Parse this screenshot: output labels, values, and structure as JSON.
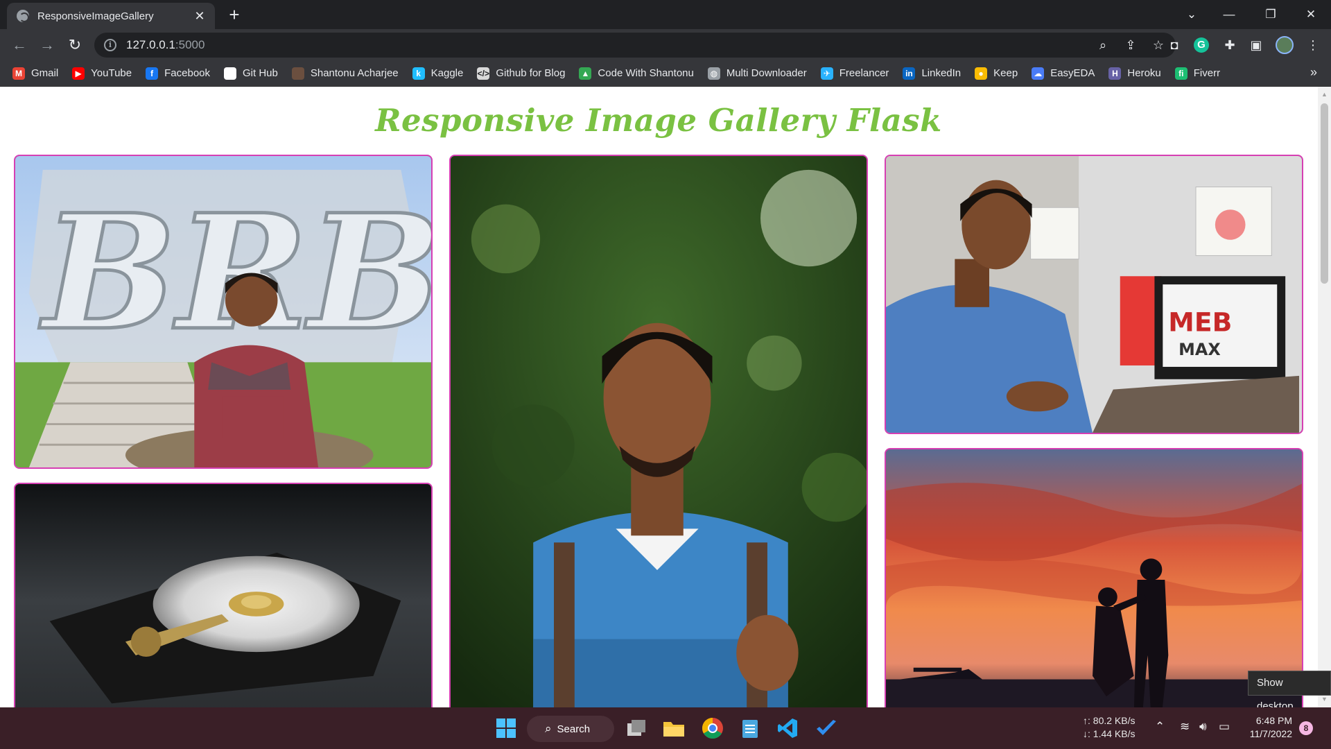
{
  "browser": {
    "tab_title": "ResponsiveImageGallery",
    "tab_close": "✕",
    "new_tab": "+",
    "url_host": "127.0.0.1",
    "url_port": ":5000"
  },
  "bookmarks": [
    {
      "label": "Gmail",
      "icon": "gmail-icon",
      "color": "#ea4335",
      "glyph": "M"
    },
    {
      "label": "YouTube",
      "icon": "youtube-icon",
      "color": "#ff0000",
      "glyph": "▶"
    },
    {
      "label": "Facebook",
      "icon": "facebook-icon",
      "color": "#1877f2",
      "glyph": "f"
    },
    {
      "label": "Git Hub",
      "icon": "github-icon",
      "color": "#ffffff",
      "glyph": ""
    },
    {
      "label": "Shantonu Acharjee",
      "icon": "avatar-icon",
      "color": "#6b4f3f",
      "glyph": ""
    },
    {
      "label": "Kaggle",
      "icon": "kaggle-icon",
      "color": "#20beff",
      "glyph": "k"
    },
    {
      "label": "Github for Blog",
      "icon": "code-icon",
      "color": "#d9d9d9",
      "glyph": "</>"
    },
    {
      "label": "Code With Shantonu",
      "icon": "drive-icon",
      "color": "#34a853",
      "glyph": "▲"
    },
    {
      "label": "Multi Downloader",
      "icon": "globe-icon",
      "color": "#9aa0a6",
      "glyph": "◍"
    },
    {
      "label": "Freelancer",
      "icon": "freelancer-icon",
      "color": "#29b2fe",
      "glyph": "✈"
    },
    {
      "label": "LinkedIn",
      "icon": "linkedin-icon",
      "color": "#0a66c2",
      "glyph": "in"
    },
    {
      "label": "Keep",
      "icon": "keep-icon",
      "color": "#fbbc04",
      "glyph": "●"
    },
    {
      "label": "EasyEDA",
      "icon": "easyeda-icon",
      "color": "#4a7cf7",
      "glyph": "☁"
    },
    {
      "label": "Heroku",
      "icon": "heroku-icon",
      "color": "#6762a6",
      "glyph": "H"
    },
    {
      "label": "Fiverr",
      "icon": "fiverr-icon",
      "color": "#1dbf73",
      "glyph": "fi"
    }
  ],
  "page": {
    "title": "Responsive Image Gallery Flask"
  },
  "tooltip": "Show desktop",
  "taskbar": {
    "search_label": "Search",
    "net_up": "↑: 80.2 KB/s",
    "net_down": "↓: 1.44 KB/s",
    "time": "6:48 PM",
    "date": "11/7/2022",
    "notifications": "8"
  },
  "colors": {
    "title_green": "#7ac142",
    "card_border": "#d63fb3",
    "taskbar_bg": "#3a1f27"
  }
}
